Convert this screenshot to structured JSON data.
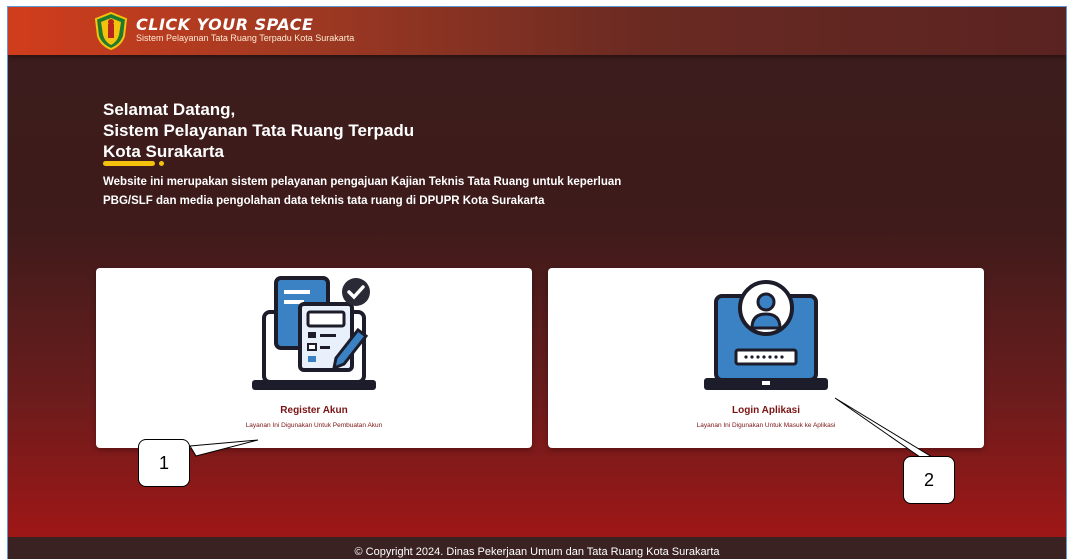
{
  "header": {
    "title": "CLICK YOUR SPACE",
    "subtitle": "Sistem Pelayanan Tata Ruang Terpadu Kota Surakarta",
    "logo_icon": "city-emblem-icon"
  },
  "hero": {
    "line1": "Selamat Datang,",
    "line2": "Sistem Pelayanan Tata Ruang Terpadu",
    "line3": "Kota Surakarta",
    "description": "Website ini merupakan sistem pelayanan pengajuan Kajian Teknis Tata Ruang untuk keperluan PBG/SLF dan media pengolahan data teknis tata ruang di DPUPR Kota Surakarta",
    "accent_color": "#f4c20d"
  },
  "cards": {
    "register": {
      "title": "Register Akun",
      "subtitle": "Layanan Ini Digunakan Untuk Pembuatan Akun",
      "icon": "document-register-icon"
    },
    "login": {
      "title": "Login Aplikasi",
      "subtitle": "Layanan Ini Digunakan Untuk Masuk ke Aplikasi",
      "icon": "laptop-login-icon"
    }
  },
  "footer": {
    "text": "© Copyright 2024. Dinas Pekerjaan Umum dan Tata Ruang Kota Surakarta"
  },
  "annotations": {
    "callout1": "1",
    "callout2": "2"
  },
  "colors": {
    "topbar_start": "#d13d1c",
    "background_dark": "#3b1c1c",
    "background_red": "#a71616",
    "card_text": "#7a1414"
  }
}
